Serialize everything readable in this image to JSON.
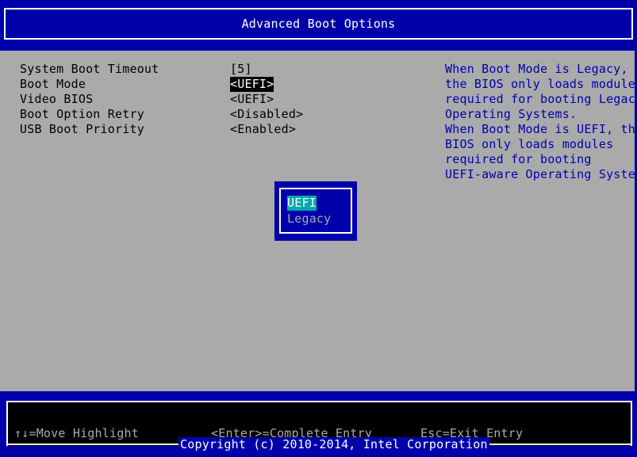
{
  "header": {
    "title": "Advanced Boot Options"
  },
  "settings": [
    {
      "label": "System Boot Timeout",
      "value": "[5]",
      "selected": false
    },
    {
      "label": "Boot Mode",
      "value": "<UEFI>",
      "selected": true
    },
    {
      "label": "Video BIOS",
      "value": "<UEFI>",
      "selected": false
    },
    {
      "label": "Boot Option Retry",
      "value": "<Disabled>",
      "selected": false
    },
    {
      "label": "USB Boot Priority",
      "value": "<Enabled>",
      "selected": false
    }
  ],
  "help": {
    "lines": [
      "When Boot Mode is Legacy,",
      "the BIOS only loads modules",
      "required for booting Legacy",
      "Operating Systems.",
      "When Boot Mode is UEFI, the",
      "BIOS only loads modules",
      "required for booting",
      "UEFI-aware Operating Systems."
    ]
  },
  "popup": {
    "options": [
      "UEFI",
      "Legacy"
    ],
    "selected_index": 0
  },
  "footer": {
    "hints": {
      "move": "↑↓=Move Highlight",
      "enter": "<Enter>=Complete Entry",
      "esc": "Esc=Exit Entry"
    },
    "copyright": "Copyright (c) 2010-2014, Intel Corporation"
  },
  "colors": {
    "bios_blue": "#0000aa",
    "panel_gray": "#aaaaaa",
    "highlight_cyan": "#00aaaa",
    "text_white": "#ffffff",
    "text_black": "#000000"
  }
}
